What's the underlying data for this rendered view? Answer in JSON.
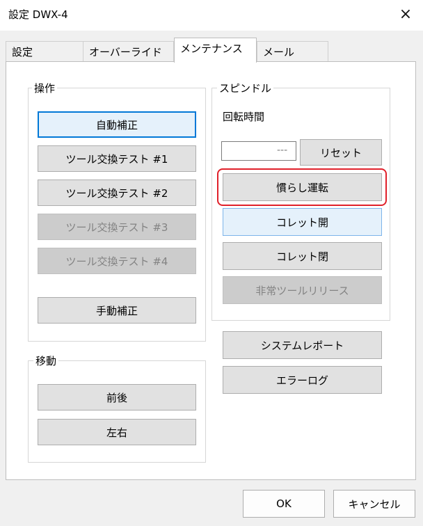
{
  "window": {
    "title": "設定 DWX-4",
    "close_glyph": "×"
  },
  "tabs": [
    {
      "label": "設定",
      "active": false
    },
    {
      "label": "オーバーライド",
      "active": false
    },
    {
      "label": "メンテナンス",
      "active": true
    },
    {
      "label": "メール",
      "active": false
    }
  ],
  "operation_group": {
    "label": "操作",
    "auto_correct": "自動補正",
    "tool_change_1": "ツール交換テスト #1",
    "tool_change_2": "ツール交換テスト #2",
    "tool_change_3": "ツール交換テスト #3",
    "tool_change_4": "ツール交換テスト #4",
    "manual_correct": "手動補正"
  },
  "move_group": {
    "label": "移動",
    "front_back": "前後",
    "left_right": "左右"
  },
  "spindle_group": {
    "label": "スピンドル",
    "rotation_time_label": "回転時間",
    "rotation_time_value": "---",
    "reset": "リセット",
    "warm_up": "慣らし運転",
    "collet_open": "コレット開",
    "collet_close": "コレット閉",
    "emergency_release": "非常ツールリリース"
  },
  "system_report": "システムレポート",
  "error_log": "エラーログ",
  "footer": {
    "ok": "OK",
    "cancel": "キャンセル"
  }
}
